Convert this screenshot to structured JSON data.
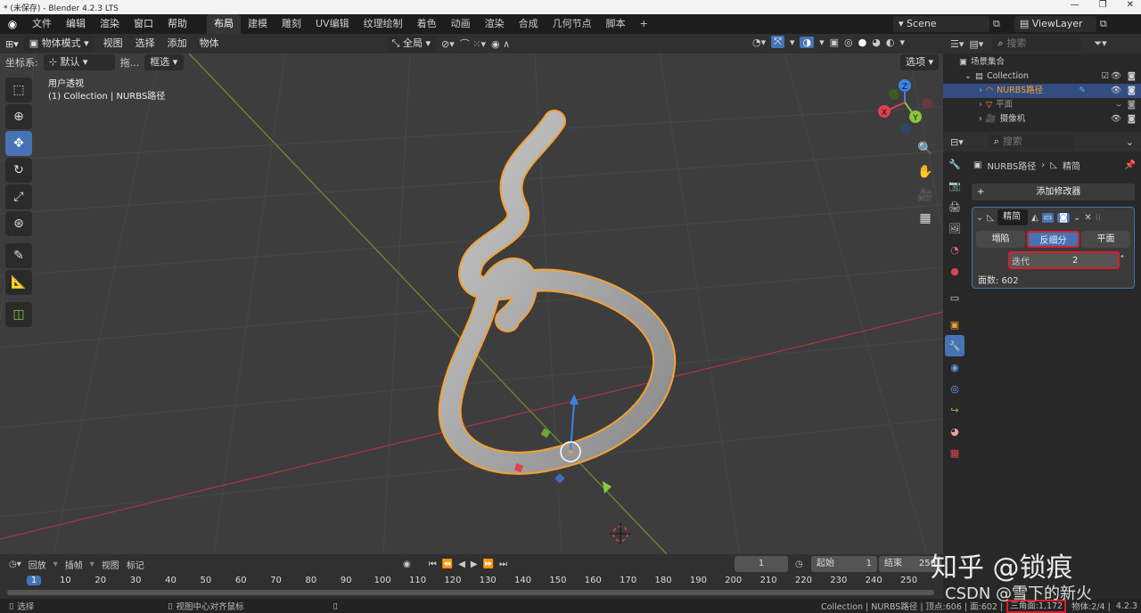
{
  "window": {
    "title": "* (未保存) - Blender 4.2.3 LTS",
    "controls": [
      "—",
      "❐",
      "✕"
    ]
  },
  "menu": [
    "文件",
    "编辑",
    "渲染",
    "窗口",
    "帮助"
  ],
  "workspaces": [
    "布局",
    "建模",
    "雕刻",
    "UV编辑",
    "纹理绘制",
    "着色",
    "动画",
    "渲染",
    "合成",
    "几何节点",
    "脚本"
  ],
  "workspace_add": "+",
  "scene": {
    "name": "Scene",
    "view_layer": "ViewLayer"
  },
  "viewport_header": {
    "mode": "物体模式",
    "menus": [
      "视图",
      "选择",
      "添加",
      "物体"
    ],
    "transform_orientation": "全局"
  },
  "viewport_header2": {
    "coord_label": "坐标系:",
    "coord_value": "默认",
    "drag_label": "拖...",
    "drag_value": "框选",
    "options_label": "选项"
  },
  "viewport": {
    "view_name": "用户透视",
    "collection_info": "(1) Collection | NURBS路径",
    "gizmo_axes": {
      "x": "X",
      "y": "Y",
      "z": "Z"
    },
    "colors": {
      "object_outline": "#f5a032",
      "grid": "#4a4a4a",
      "x_axis": "#c04a55",
      "y_axis": "#7a9a32"
    }
  },
  "tools": [
    "select-box-icon",
    "cursor-icon",
    "move-icon",
    "rotate-icon",
    "scale-icon",
    "transform-icon",
    "annotate-icon",
    "measure-icon",
    "add-cube-icon"
  ],
  "outliner": {
    "search_placeholder": "搜索",
    "scene_collection": "场景集合",
    "items": [
      {
        "label": "Collection",
        "depth": 1
      },
      {
        "label": "NURBS路径",
        "depth": 2,
        "selected": true
      },
      {
        "label": "平面",
        "depth": 2
      },
      {
        "label": "摄像机",
        "depth": 2
      }
    ]
  },
  "properties": {
    "search_placeholder": "搜索",
    "breadcrumb_object": "NURBS路径",
    "breadcrumb_modifier": "精简",
    "add_modifier": "添加修改器",
    "modifier_name": "精简",
    "modes": [
      "塌陷",
      "反细分",
      "平面"
    ],
    "active_mode": "反细分",
    "iterations_label": "迭代",
    "iterations_value": "2",
    "face_count": "面数: 602"
  },
  "timeline": {
    "menus": [
      "回放",
      "插帧",
      "视图",
      "标记"
    ],
    "current_frame": "1",
    "start_label": "起始",
    "start_value": "1",
    "end_label": "结束",
    "end_value": "250",
    "ruler": [
      "1",
      "10",
      "20",
      "30",
      "40",
      "50",
      "60",
      "70",
      "80",
      "90",
      "100",
      "110",
      "120",
      "130",
      "140",
      "150",
      "160",
      "170",
      "180",
      "190",
      "200",
      "210",
      "220",
      "230",
      "240",
      "250"
    ]
  },
  "statusbar": {
    "left_action": "选择",
    "middle_action": "视图中心对齐鼠标",
    "info": "Collection | NURBS路径 | 顶点:606 | 面:602 |",
    "triangles": "三角面:1,172",
    "extra": "物体:2/4 |",
    "version": "4.2.3"
  },
  "watermark": {
    "line1": "知乎 @锁痕",
    "line2": "CSDN @雪下的新火"
  }
}
